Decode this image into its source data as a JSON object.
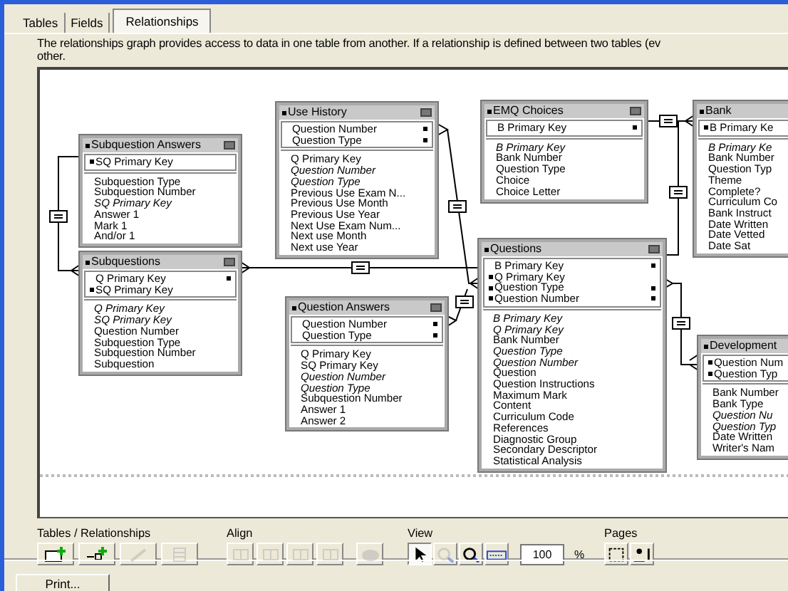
{
  "tabs": [
    {
      "label": "Tables",
      "selected": false
    },
    {
      "label": "Fields",
      "selected": false
    },
    {
      "label": "Relationships",
      "selected": true
    }
  ],
  "description": [
    "The relationships graph provides access to data in one table from another. If a relationship is defined between two tables (ev",
    "other."
  ],
  "tables": [
    {
      "title": "Subquestion Answers",
      "keys": [
        {
          "name": "SQ Primary Key",
          "lead": true,
          "trail": false
        }
      ],
      "fields": [
        {
          "name": "Subquestion Type",
          "italic": false
        },
        {
          "name": "Subquestion Number",
          "italic": false
        },
        {
          "name": "SQ Primary Key",
          "italic": true
        },
        {
          "name": "Answer 1",
          "italic": false
        },
        {
          "name": "Mark 1",
          "italic": false
        },
        {
          "name": "And/or 1",
          "italic": false
        }
      ]
    },
    {
      "title": "Subquestions",
      "keys": [
        {
          "name": "Q Primary Key",
          "lead": false,
          "trail": true
        },
        {
          "name": "SQ Primary Key",
          "lead": true,
          "trail": false
        }
      ],
      "fields": [
        {
          "name": "Q Primary Key",
          "italic": true
        },
        {
          "name": "SQ Primary Key",
          "italic": true
        },
        {
          "name": "Question Number",
          "italic": false
        },
        {
          "name": "Subquestion Type",
          "italic": false
        },
        {
          "name": "Subquestion Number",
          "italic": false
        },
        {
          "name": "Subquestion",
          "italic": false
        }
      ]
    },
    {
      "title": "Use History",
      "keys": [
        {
          "name": "Question Number",
          "lead": false,
          "trail": true
        },
        {
          "name": "Question Type",
          "lead": false,
          "trail": true
        }
      ],
      "fields": [
        {
          "name": "Q Primary Key",
          "italic": false
        },
        {
          "name": "Question Number",
          "italic": true
        },
        {
          "name": "Question Type",
          "italic": true
        },
        {
          "name": "Previous Use Exam N...",
          "italic": false
        },
        {
          "name": "Previous Use Month",
          "italic": false
        },
        {
          "name": "Previous Use Year",
          "italic": false
        },
        {
          "name": "Next Use Exam Num...",
          "italic": false
        },
        {
          "name": "Next use Month",
          "italic": false
        },
        {
          "name": "Next use Year",
          "italic": false
        }
      ]
    },
    {
      "title": "Question Answers",
      "keys": [
        {
          "name": "Question Number",
          "lead": false,
          "trail": true
        },
        {
          "name": "Question Type",
          "lead": false,
          "trail": true
        }
      ],
      "fields": [
        {
          "name": "Q Primary Key",
          "italic": false
        },
        {
          "name": "SQ Primary Key",
          "italic": false
        },
        {
          "name": "Question Number",
          "italic": true
        },
        {
          "name": "Question Type",
          "italic": true
        },
        {
          "name": "Subquestion Number",
          "italic": false
        },
        {
          "name": "Answer 1",
          "italic": false
        },
        {
          "name": "Answer 2",
          "italic": false
        }
      ]
    },
    {
      "title": "EMQ Choices",
      "keys": [
        {
          "name": "B Primary Key",
          "lead": false,
          "trail": true
        }
      ],
      "fields": [
        {
          "name": "B Primary Key",
          "italic": true
        },
        {
          "name": "Bank Number",
          "italic": false
        },
        {
          "name": "Question Type",
          "italic": false
        },
        {
          "name": "Choice",
          "italic": false
        },
        {
          "name": "Choice Letter",
          "italic": false
        }
      ]
    },
    {
      "title": "Questions",
      "keys": [
        {
          "name": "B Primary Key",
          "lead": false,
          "trail": true
        },
        {
          "name": "Q Primary Key",
          "lead": true,
          "trail": false
        },
        {
          "name": "Question Type",
          "lead": true,
          "trail": true
        },
        {
          "name": "Question Number",
          "lead": true,
          "trail": true
        }
      ],
      "fields": [
        {
          "name": "B Primary Key",
          "italic": true
        },
        {
          "name": "Q Primary Key",
          "italic": true
        },
        {
          "name": "Bank Number",
          "italic": false
        },
        {
          "name": "Question Type",
          "italic": true
        },
        {
          "name": "Question Number",
          "italic": true
        },
        {
          "name": "Question",
          "italic": false
        },
        {
          "name": "Question Instructions",
          "italic": false
        },
        {
          "name": "Maximum Mark",
          "italic": false
        },
        {
          "name": "Content",
          "italic": false
        },
        {
          "name": "Curriculum Code",
          "italic": false
        },
        {
          "name": "References",
          "italic": false
        },
        {
          "name": "Diagnostic Group",
          "italic": false
        },
        {
          "name": "Secondary Descriptor",
          "italic": false
        },
        {
          "name": "Statistical Analysis",
          "italic": false
        }
      ]
    },
    {
      "title": "Bank",
      "keys": [
        {
          "name": "B Primary Ke",
          "lead": true,
          "trail": false
        }
      ],
      "fields": [
        {
          "name": "B Primary Ke",
          "italic": true
        },
        {
          "name": "Bank Number",
          "italic": false
        },
        {
          "name": "Question Typ",
          "italic": false
        },
        {
          "name": "Theme",
          "italic": false
        },
        {
          "name": "Complete?",
          "italic": false
        },
        {
          "name": "Curriculum Co",
          "italic": false
        },
        {
          "name": "Bank Instruct",
          "italic": false
        },
        {
          "name": "Date Written",
          "italic": false
        },
        {
          "name": "Date Vetted",
          "italic": false
        },
        {
          "name": "Date Sat",
          "italic": false
        }
      ]
    },
    {
      "title": "Development",
      "keys": [
        {
          "name": "Question Num",
          "lead": true,
          "trail": false
        },
        {
          "name": "Question Typ",
          "lead": true,
          "trail": false
        }
      ],
      "fields": [
        {
          "name": "Bank Number",
          "italic": false
        },
        {
          "name": "Bank Type",
          "italic": false
        },
        {
          "name": "Question Nu",
          "italic": true
        },
        {
          "name": "Question Typ",
          "italic": true
        },
        {
          "name": "Date Written",
          "italic": false
        },
        {
          "name": "Writer's Nam",
          "italic": false
        }
      ]
    }
  ],
  "toolbar": [
    {
      "label": "Tables / Relationships",
      "buttons": [
        {
          "disabled": false,
          "selected": false
        },
        {
          "disabled": false,
          "selected": false
        },
        {
          "disabled": true,
          "selected": false
        },
        {
          "disabled": true,
          "selected": false
        }
      ]
    },
    {
      "label": "Align",
      "buttons": [
        {
          "disabled": true,
          "selected": false
        },
        {
          "disabled": true,
          "selected": false
        },
        {
          "disabled": true,
          "selected": false
        },
        {
          "disabled": true,
          "selected": false
        },
        {
          "disabled": true,
          "selected": false
        }
      ]
    },
    {
      "label": "View",
      "buttons": [
        {
          "disabled": false,
          "selected": true
        },
        {
          "disabled": true,
          "selected": false
        },
        {
          "disabled": false,
          "selected": false
        },
        {
          "disabled": false,
          "selected": false
        }
      ],
      "zoom": "100",
      "unit": "%"
    },
    {
      "label": "Pages",
      "buttons": [
        {
          "disabled": false,
          "selected": false
        },
        {
          "disabled": false,
          "selected": false
        }
      ]
    }
  ],
  "print_button": "Print..."
}
